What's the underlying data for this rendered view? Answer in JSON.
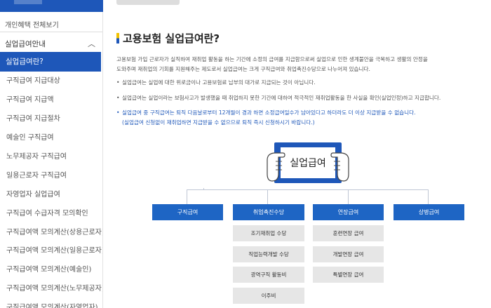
{
  "sidebar": {
    "top_link": "개인혜택 전체보기",
    "section_title": "실업급여안내",
    "section_chevron": "︿",
    "active_item": "실업급여란?",
    "items": [
      "구직급여 지급대상",
      "구직급여 지급액",
      "구직급여 지급절차",
      "예술인 구직급여",
      "노무제공자 구직급여",
      "일용근로자 구직급여",
      "자영업자 실업급여",
      "구직급여 수급자격 모의확인",
      "구직급여액 모의계산(상용근로자)",
      "구직급여액 모의계산(일용근로자)",
      "구직급여액 모의계산(예술인)",
      "구직급여액 모의계산(노무제공자)",
      "구직급여액 모의계산(자영업자)"
    ]
  },
  "main": {
    "heading": "고용보험 실업급여란?",
    "intro_line1": "고용보험 가입 근로자가 실직하여 재취업 활동을 하는 기간에 소정의 급여를 지급함으로써 실업으로 인한 생계불안을 극복하고 생활의 안정을",
    "intro_line2": "도와주며 재취업의 기회를 지원해주는 제도로서 실업급여는 크게 구직급여와 취업촉진수당으로 나누어져 있습니다.",
    "bullet_marker": "•",
    "bullets": [
      "실업급여는 실업에 대한 위로금이나 고용보험료 납부의 대가로 지급되는 것이 아닙니다.",
      "실업급여는 실업이라는 보험사고가 발생했을 때 취업하지 못한 기간에 대하여 적극적인 재취업활동을 한 사실을 확인(실업인정)하고 지급합니다."
    ],
    "notice_line1": "실업급여 중 구직급여는 퇴직 다음날로부터 12개월이 경과 하면 소정급여일수가 남아있다고 하더라도 더 이상 지급받을 수 없습니다.",
    "notice_line2": "(실업급여 신청없이 재취업하면 지급받을 수 없으므로 퇴직 즉시 신청하시기 바랍니다.)"
  },
  "diagram": {
    "center_label": "실업급여",
    "categories": [
      "구직급여",
      "취업촉진수당",
      "연장급여",
      "상병급여"
    ],
    "promotion_items": [
      "조기재취업 수당",
      "직업능력개발 수당",
      "광역구직 활동비",
      "이주비"
    ],
    "extension_items": [
      "훈련연장 급여",
      "개발연장 급여",
      "특별연장 급여"
    ]
  },
  "colors": {
    "brand_blue": "#1e57b9",
    "category_blue": "#1e65c4",
    "sub_gray": "#e6e6e6",
    "accent_yellow": "#f2c200"
  }
}
